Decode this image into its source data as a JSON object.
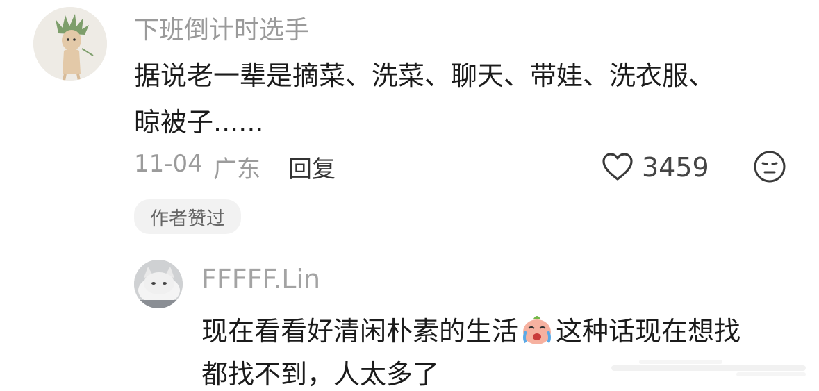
{
  "comment": {
    "username": "下班倒计时选手",
    "text_line1": "据说老一辈是摘菜、洗菜、聊天、带娃、洗衣服、",
    "text_line2": "晾被子......",
    "date": "11-04",
    "location": "广东",
    "reply_label": "回复",
    "like_count": "3459",
    "author_badge": "作者赞过"
  },
  "reply_comment": {
    "username": "FFFFF.Lin",
    "text_line1_before_emoji": "现在看看好清闲朴素的生活",
    "text_line1_after_emoji": "这种话现在想找",
    "text_line2": "都找不到，人太多了"
  },
  "icons": [
    "heart-outline-icon",
    "neutral-face-icon",
    "crying-emoji"
  ]
}
